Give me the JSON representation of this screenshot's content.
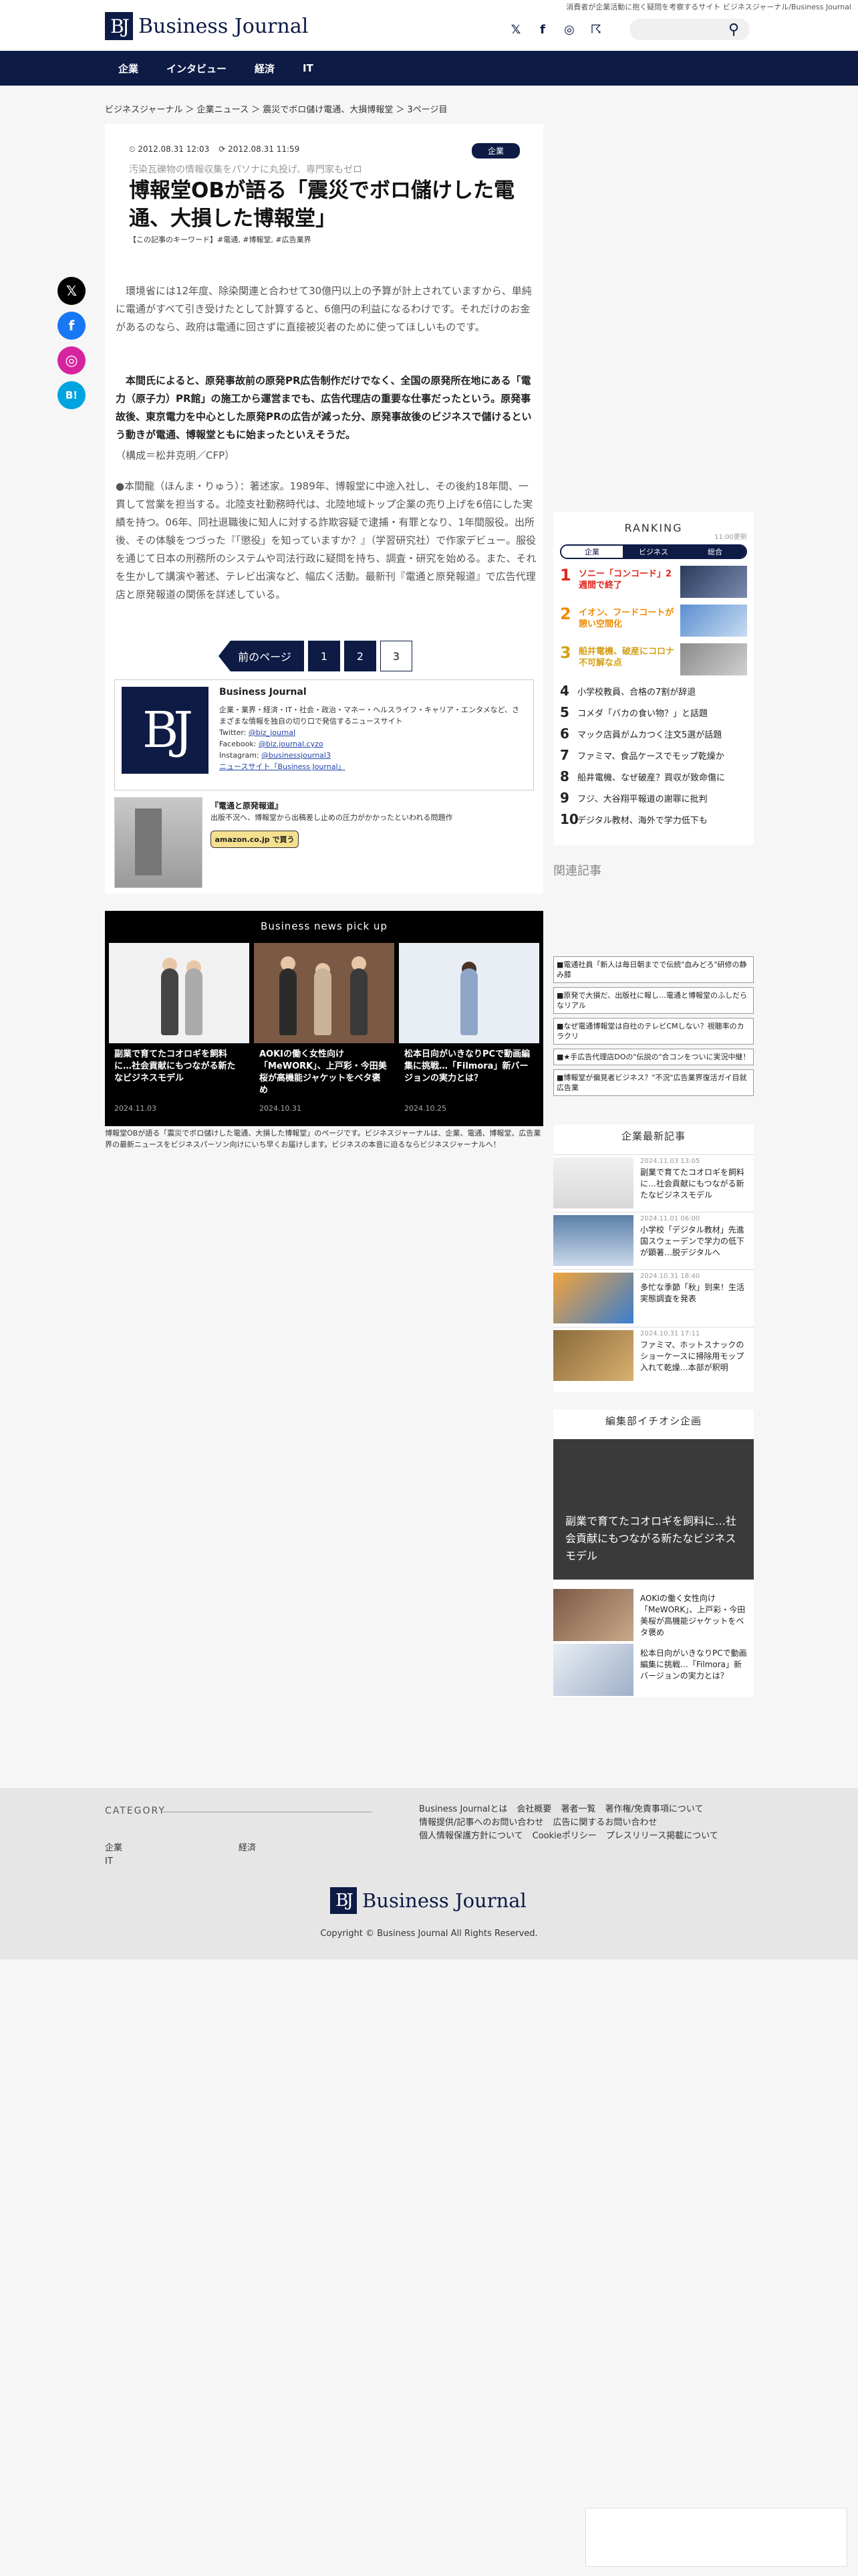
{
  "header": {
    "tagline": "消費者が企業活動に抱く疑問を考察するサイト ビジネスジャーナル/Business Journal",
    "logo_mark": "BJ",
    "logo_text": "Business Journal"
  },
  "social_top": [
    {
      "icon": "x-icon",
      "glyph": "𝕏"
    },
    {
      "icon": "facebook-icon",
      "glyph": "f"
    },
    {
      "icon": "instagram-icon",
      "glyph": "◎"
    },
    {
      "icon": "rss-icon",
      "glyph": "☈"
    }
  ],
  "search": {
    "placeholder": ""
  },
  "nav": [
    "企業",
    "インタビュー",
    "経済",
    "IT"
  ],
  "breadcrumb": "ビジネスジャーナル ＞ 企業ニュース ＞ 震災でボロ儲け電通、大損博報堂 ＞ 3ページ目",
  "article": {
    "published": "2012.08.31 12:03",
    "updated": "2012.08.31 11:59",
    "category": "企業",
    "subtitle": "汚染瓦礫物の情報収集をパソナに丸投げ、専門家もゼロ",
    "title": "博報堂OBが語る「震災でボロ儲けした電通、大損した博報堂」",
    "keywords": "【この記事のキーワード】#電通, #博報堂, #広告業界",
    "paragraphs": [
      "　環境省には12年度、除染関連と合わせて30億円以上の予算が計上されていますから、単純に電通がすべて引き受けたとして計算すると、6億円の利益になるわけです。それだけのお金があるのなら、政府は電通に回さずに直接被災者のために使ってほしいものです。",
      "　本間氏によると、原発事故前の原発PR広告制作だけでなく、全国の原発所在地にある「電力（原子力）PR館」の施工から運営までも、広告代理店の重要な仕事だったという。原発事故後、東京電力を中心とした原発PRの広告が減った分、原発事故後のビジネスで儲けるという動きが電通、博報堂ともに始まったといえそうだ。",
      "（構成＝松井克明／CFP）",
      "●本間龍（ほんま・りゅう）：著述家。1989年、博報堂に中途入社し、その後約18年間、一貫して営業を担当する。北陸支社勤務時代は、北陸地域トップ企業の売り上げを6倍にした実績を持つ。06年、同社退職後に知人に対する詐欺容疑で逮捕・有罪となり、1年間服役。出所後、その体験をつづった『「懲役」を知っていますか？』（学習研究社）で作家デビュー。服役を通じて日本の刑務所のシステムや司法行政に疑問を持ち、調査・研究を始める。また、それを生かして講演や著述、テレビ出演など、幅広く活動。最新刊『電通と原発報道』で広告代理店と原発報道の関係を詳述している。"
    ]
  },
  "pager": {
    "prev": "前のページ",
    "pages": [
      "1",
      "2",
      "3"
    ],
    "current": "3"
  },
  "author": {
    "logo": "BJ",
    "name": "Business Journal",
    "desc": "企業・業界・経済・IT・社会・政治・マネー・ヘルスライフ・キャリア・エンタメなど、さまざまな情報を独自の切り口で発信するニュースサイト",
    "twitter_label": "Twitter: ",
    "twitter": "@biz_journal",
    "facebook_label": "Facebook: ",
    "facebook": "@biz.journal.cyzo",
    "instagram_label": "Instagram: ",
    "instagram": "@businessjournal3",
    "site": "ニュースサイト「Business Journal」"
  },
  "book": {
    "title": "『電通と原発報道』",
    "desc": "出版不況へ、博報堂から出稿差し止めの圧力がかかったといわれる問題作",
    "button": "amazon.co.jp で買う"
  },
  "pickup": {
    "title": "Business news pick up",
    "items": [
      {
        "text": "副業で育てたコオロギを飼料に…社会貢献にもつながる新たなビジネスモデル",
        "date": "2024.11.03"
      },
      {
        "text": "AOKIの働く女性向け「MeWORK」、上戸彩・今田美桜が高機能ジャケットをベタ褒め",
        "date": "2024.10.31"
      },
      {
        "text": "松本日向がいきなりPCで動画編集に挑戦…「Filmora」新バージョンの実力とは？",
        "date": "2024.10.25"
      }
    ]
  },
  "site_desc": "博報堂OBが語る「震災でボロ儲けした電通、大損した博報堂」のページです。ビジネスジャーナルは、企業、電通、博報堂、広告業界の最新ニュースをビジネスパーソン向けにいち早くお届けします。ビジネスの本音に迫るならビジネスジャーナルへ！",
  "sticky_social": [
    {
      "icon": "x-icon",
      "glyph": "𝕏",
      "color": "#000000"
    },
    {
      "icon": "facebook-icon",
      "glyph": "f",
      "color": "#1877f2"
    },
    {
      "icon": "instagram-icon",
      "glyph": "◎",
      "color": "#d6249f"
    },
    {
      "icon": "hatena-icon",
      "glyph": "B!",
      "color": "#00a4de"
    }
  ],
  "ranking": {
    "title": "RANKING",
    "time": "11:00更新",
    "tabs": [
      "企業",
      "ビジネス",
      "総合"
    ],
    "active_tab": "企業",
    "top": [
      {
        "no": "1",
        "text": "ソニー「コンコード」2週間で終了",
        "color": "#e0261a"
      },
      {
        "no": "2",
        "text": "イオン、フードコートが憩い空間化",
        "color": "#ef8c00"
      },
      {
        "no": "3",
        "text": "船井電機、破産にコロナ不可解な点",
        "color": "#d4a017"
      }
    ],
    "rest": [
      {
        "no": "4",
        "text": "小学校教員、合格の7割が辞退"
      },
      {
        "no": "5",
        "text": "コメダ「バカの食い物？」と話題"
      },
      {
        "no": "6",
        "text": "マック店員がムカつく注文5選が話題"
      },
      {
        "no": "7",
        "text": "ファミマ、食品ケースでモップ乾燥か"
      },
      {
        "no": "8",
        "text": "船井電機、なぜ破産？買収が致命傷に"
      },
      {
        "no": "9",
        "text": "フジ、大谷翔平報道の謝罪に批判"
      },
      {
        "no": "10",
        "text": "デジタル教材、海外で学力低下も"
      }
    ]
  },
  "related": {
    "heading": "関連記事",
    "links": [
      "■電通社員「新人は毎日朝までで伝統\"血みどろ\"研修の静み膝",
      "■原発で大損だ、出版社に報し…電通と博報堂のふしだらなリアル",
      "■なぜ電通博報堂は自社のテレビCMしない？視聴率のカラクリ",
      "■★手広告代理店DOの\"伝説の\"合コンをついに実況中継！",
      "■博報堂が偏見者ビジネス？\"不況\"広告業界復活ガイ目就広告業"
    ]
  },
  "company": {
    "heading": "企業最新記事",
    "items": [
      {
        "date": "2024.11.03 13:05",
        "text": "副業で育てたコオロギを飼料に…社会貢献にもつながる新たなビジネスモデル"
      },
      {
        "date": "2024.11.01 06:00",
        "text": "小学校「デジタル教材」先進国スウェーデンで学力の低下が顕著…脱デジタルへ"
      },
      {
        "date": "2024.10.31 18:40",
        "text": "多忙な季節「秋」到来！生活実態調査を発表"
      },
      {
        "date": "2024.10.31 17:11",
        "text": "ファミマ、ホットスナックのショーケースに掃除用モップ入れて乾燥…本部が釈明"
      }
    ]
  },
  "editor": {
    "heading": "編集部イチオシ企画",
    "hero": "副業で育てたコオロギを飼料に…社会貢献にもつながる新たなビジネスモデル",
    "items": [
      {
        "text": "AOKIの働く女性向け「MeWORK」、上戸彩・今田美桜が高機能ジャケットをベタ褒め"
      },
      {
        "text": "松本日向がいきなりPCで動画編集に挑戦…「Filmora」新バージョンの実力とは？"
      }
    ]
  },
  "footer": {
    "category_heading": "CATEGORY",
    "categories": [
      "企業",
      "経済",
      "IT"
    ],
    "links": [
      "Business Journalとは",
      "会社概要",
      "著者一覧",
      "著作権/免責事項について",
      "情報提供/記事へのお問い合わせ",
      "広告に関するお問い合わせ",
      "個人情報保護方針について",
      "Cookieポリシー",
      "プレスリリース掲載について"
    ],
    "logo_mark": "BJ",
    "logo_text": "Business Journal",
    "copyright": "Copyright © Business Journal All Rights Reserved."
  }
}
